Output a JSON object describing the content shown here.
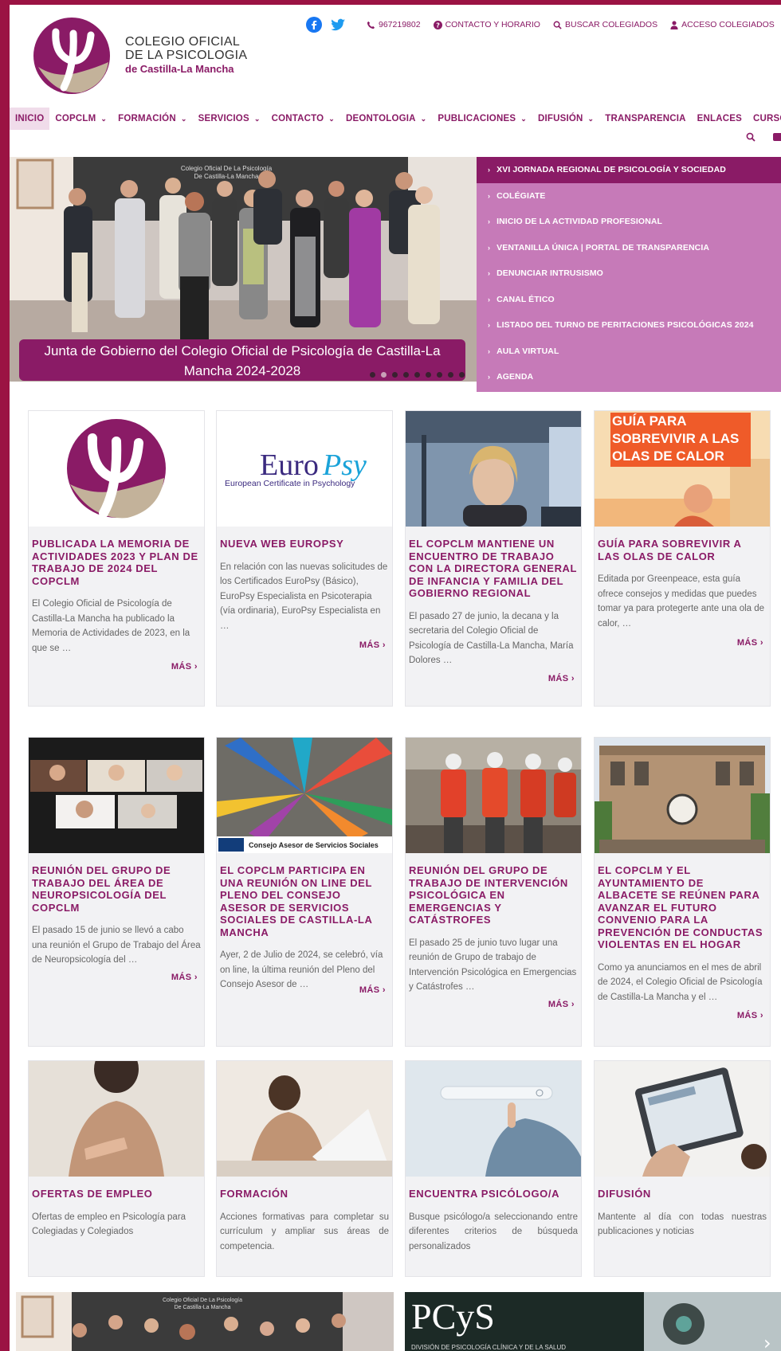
{
  "header": {
    "logo_line1": "COLEGIO OFICIAL",
    "logo_line2": "DE LA PSICOLOGIA",
    "logo_line3": "de Castilla-La Mancha",
    "phone": "967219802",
    "contact": "CONTACTO Y HORARIO",
    "search": "BUSCAR COLEGIADOS",
    "access": "ACCESO COLEGIADOS",
    "social": [
      "facebook-icon",
      "twitter-icon"
    ],
    "brand_color": "#8a1b66"
  },
  "nav": {
    "items": [
      "INICIO",
      "COPCLM",
      "FORMACIÓN",
      "SERVICIOS",
      "CONTACTO",
      "DEONTOLOGIA",
      "PUBLICACIONES",
      "DIFUSIÓN",
      "TRANSPARENCIA",
      "ENLACES",
      "CURSOS"
    ]
  },
  "hero": {
    "caption": "Junta de Gobierno del Colegio Oficial de Psicología de Castilla-La Mancha 2024-2028",
    "sign_line1": "Colegio Oficial De La Psicología",
    "sign_line2": "De Castilla-La Mancha"
  },
  "quick_links": [
    "XVI JORNADA REGIONAL DE PSICOLOGÍA Y SOCIEDAD",
    "COLÉGIATE",
    "INICIO DE LA ACTIVIDAD PROFESIONAL",
    "VENTANILLA ÚNICA | PORTAL DE TRANSPARENCIA",
    "DENUNCIAR INTRUSISMO",
    "CANAL ÉTICO",
    "LISTADO DEL TURNO DE PERITACIONES PSICOLÓGICAS 2024",
    "AULA VIRTUAL",
    "AGENDA"
  ],
  "news": [
    {
      "title": "PUBLICADA LA MEMORIA DE ACTIVIDADES 2023 Y PLAN DE TRABAJO DE 2024 DEL COPCLM",
      "excerpt": "El Colegio Oficial de Psicología de Castilla-La Mancha ha publicado la Memoria de Actividades de 2023, en la que se …",
      "more": "MÁS ›"
    },
    {
      "title": "NUEVA WEB EUROPSY",
      "excerpt": "En relación con las nuevas solicitudes de los Certificados EuroPsy (Básico), EuroPsy Especialista en Psicoterapia (vía ordinaria), EuroPsy Especialista en …",
      "more": "MÁS ›",
      "thumb_text1": "Euro",
      "thumb_text2": "Psy",
      "thumb_sub": "European Certificate in Psychology"
    },
    {
      "title": "EL COPCLM MANTIENE UN ENCUENTRO DE TRABAJO CON LA DIRECTORA GENERAL DE INFANCIA Y FAMILIA DEL GOBIERNO REGIONAL",
      "excerpt": "El pasado 27 de junio, la decana y la secretaria del Colegio Oficial de Psicología de Castilla-La Mancha, María Dolores …",
      "more": "MÁS ›"
    },
    {
      "title": "GUÍA PARA SOBREVIVIR A LAS OLAS DE CALOR",
      "excerpt": "Editada por Greenpeace, esta guía ofrece consejos y medidas que puedes tomar ya para protegerte ante una ola de calor, …",
      "more": "MÁS ›",
      "thumb_text": "GUÍA PARA SOBREVIVIR A LAS OLAS DE CALOR"
    },
    {
      "title": "REUNIÓN DEL GRUPO DE TRABAJO DEL ÁREA DE NEUROPSICOLOGÍA DEL COPCLM",
      "excerpt": "El pasado 15 de junio se llevó a cabo una reunión el Grupo de Trabajo del Área de Neuropsicología del …",
      "more": "MÁS ›"
    },
    {
      "title": "EL COPCLM PARTICIPA EN UNA REUNIÓN ON LINE DEL PLENO DEL CONSEJO ASESOR DE SERVICIOS SOCIALES DE CASTILLA-LA MANCHA",
      "excerpt": "Ayer, 2 de Julio de 2024, se celebró, vía on line, la última reunión del Pleno del Consejo Asesor de …",
      "more": "MÁS ›",
      "thumb_text": "Consejo Asesor de Servicios Sociales"
    },
    {
      "title": "REUNIÓN DEL GRUPO DE TRABAJO DE INTERVENCIÓN PSICOLÓGICA EN EMERGENCIAS Y CATÁSTROFES",
      "excerpt": "El pasado 25 de junio tuvo lugar una reunión de Grupo de trabajo de Intervención Psicológica en Emergencias y Catástrofes …",
      "more": "MÁS ›"
    },
    {
      "title": "EL COPCLM Y EL AYUNTAMIENTO DE ALBACETE SE REÚNEN PARA AVANZAR EL FUTURO CONVENIO PARA LA PREVENCIÓN DE CONDUCTAS VIOLENTAS EN EL HOGAR",
      "excerpt": "Como ya anunciamos en el mes de abril de 2024, el Colegio Oficial de Psicología de Castilla-La Mancha y el …",
      "more": "MÁS ›"
    }
  ],
  "sections": [
    {
      "title": "OFERTAS DE EMPLEO",
      "excerpt": "Ofertas de empleo en Psicología para Colegiadas y Colegiados"
    },
    {
      "title": "FORMACIÓN",
      "excerpt": "Acciones formativas para completar su currículum y ampliar sus áreas de competencia."
    },
    {
      "title": "ENCUENTRA PSICÓLOGO/A",
      "excerpt": "Busque psicólogo/a seleccionando entre diferentes criterios de búsqueda personalizados"
    },
    {
      "title": "DIFUSIÓN",
      "excerpt": "Mantente al día con todas nuestras publicaciones y noticias"
    }
  ],
  "banners": {
    "left_sign1": "Colegio Oficial De La Psicología",
    "left_sign2": "De Castilla-La Mancha",
    "right_title": "PCyS",
    "right_sub": "DIVISIÓN DE PSICOLOGÍA CLÍNICA Y DE LA SALUD"
  }
}
